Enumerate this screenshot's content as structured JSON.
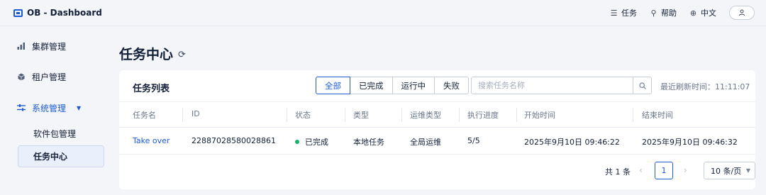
{
  "app": {
    "title": "OB - Dashboard"
  },
  "header": {
    "tasks_label": "任务",
    "help_label": "帮助",
    "language_label": "中文"
  },
  "sidebar": {
    "items": [
      {
        "label": "集群管理",
        "icon": "bar-chart-icon"
      },
      {
        "label": "租户管理",
        "icon": "cube-icon"
      },
      {
        "label": "系统管理",
        "icon": "sliders-icon"
      }
    ],
    "sub_items": [
      {
        "label": "软件包管理"
      },
      {
        "label": "任务中心"
      }
    ]
  },
  "page": {
    "title": "任务中心"
  },
  "card": {
    "title": "任务列表",
    "filters": [
      "全部",
      "已完成",
      "运行中",
      "失败"
    ],
    "active_filter": "全部",
    "search_placeholder": "搜索任务名称",
    "refresh_time": "最近刷新时间：11:11:07"
  },
  "table": {
    "columns": [
      "任务名",
      "ID",
      "状态",
      "类型",
      "运维类型",
      "执行进度",
      "开始时间",
      "结束时间"
    ],
    "rows": [
      {
        "name": "Take over",
        "id": "22887028580028861",
        "status": "已完成",
        "type": "本地任务",
        "ops_type": "全局运维",
        "progress": "5/5",
        "start": "2025年9月10日 09:46:22",
        "end": "2025年9月10日 09:46:32"
      }
    ]
  },
  "pagination": {
    "total": "共 1 条",
    "current_page": "1",
    "page_size": "10 条/页"
  },
  "colors": {
    "accent": "#1b5bd6",
    "success": "#17b26a",
    "background": "#f3f5f8"
  }
}
